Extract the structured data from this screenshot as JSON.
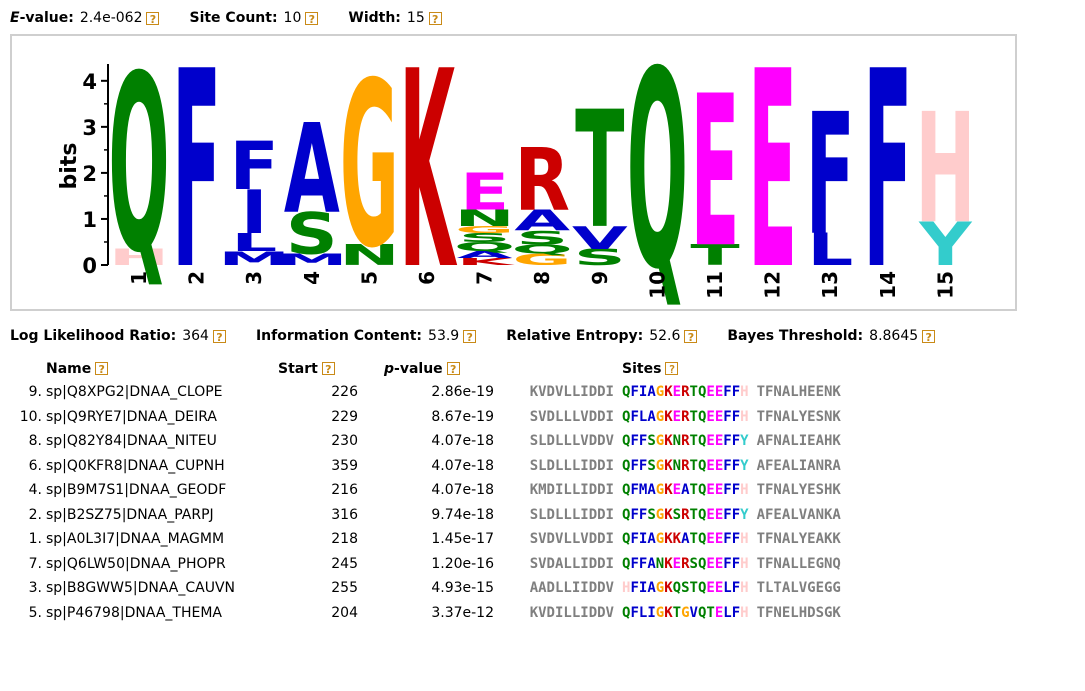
{
  "header": {
    "evalue": {
      "label": "E-value:",
      "value": "2.4e-062"
    },
    "site_count": {
      "label": "Site Count:",
      "value": "10"
    },
    "width": {
      "label": "Width:",
      "value": "15"
    }
  },
  "help_icon": {
    "glyph": "?",
    "color": "#c98a17"
  },
  "logo": {
    "ylabel": "bits",
    "y_ticks": [
      "0",
      "1",
      "2",
      "3",
      "4"
    ],
    "ylim": [
      0,
      4.3
    ],
    "positions": [
      "1",
      "2",
      "3",
      "4",
      "5",
      "6",
      "7",
      "8",
      "9",
      "10",
      "11",
      "12",
      "13",
      "14",
      "15"
    ],
    "columns": [
      [
        {
          "l": "H",
          "b": 0.35
        },
        {
          "l": "Q",
          "b": 3.85
        }
      ],
      [
        {
          "l": "F",
          "b": 4.3
        }
      ],
      [
        {
          "l": "M",
          "b": 0.3
        },
        {
          "l": "L",
          "b": 0.4
        },
        {
          "l": "I",
          "b": 0.95
        },
        {
          "l": "F",
          "b": 1.05
        }
      ],
      [
        {
          "l": "M",
          "b": 0.25
        },
        {
          "l": "S",
          "b": 0.9
        },
        {
          "l": "A",
          "b": 1.95
        }
      ],
      [
        {
          "l": "N",
          "b": 0.45
        },
        {
          "l": "G",
          "b": 3.6
        }
      ],
      [
        {
          "l": "K",
          "b": 4.3
        }
      ],
      [
        {
          "l": "K",
          "b": 0.15
        },
        {
          "l": "A",
          "b": 0.15
        },
        {
          "l": "Q",
          "b": 0.2
        },
        {
          "l": "S",
          "b": 0.2
        },
        {
          "l": "G",
          "b": 0.15
        },
        {
          "l": "N",
          "b": 0.35
        },
        {
          "l": "E",
          "b": 0.8
        }
      ],
      [
        {
          "l": "G",
          "b": 0.25
        },
        {
          "l": "Q",
          "b": 0.2
        },
        {
          "l": "S",
          "b": 0.3
        },
        {
          "l": "A",
          "b": 0.45
        },
        {
          "l": "R",
          "b": 1.35
        }
      ],
      [
        {
          "l": "S",
          "b": 0.35
        },
        {
          "l": "V",
          "b": 0.5
        },
        {
          "l": "T",
          "b": 2.55
        }
      ],
      [
        {
          "l": "Q",
          "b": 4.3
        }
      ],
      [
        {
          "l": "T",
          "b": 0.45
        },
        {
          "l": "E",
          "b": 3.3
        }
      ],
      [
        {
          "l": "E",
          "b": 4.3
        }
      ],
      [
        {
          "l": "L",
          "b": 0.7
        },
        {
          "l": "F",
          "b": 2.65
        }
      ],
      [
        {
          "l": "F",
          "b": 4.3
        }
      ],
      [
        {
          "l": "Y",
          "b": 0.95
        },
        {
          "l": "H",
          "b": 2.4
        }
      ]
    ]
  },
  "stats2": {
    "llr": {
      "label": "Log Likelihood Ratio:",
      "value": "364"
    },
    "ic": {
      "label": "Information Content:",
      "value": "53.9"
    },
    "re": {
      "label": "Relative Entropy:",
      "value": "52.6"
    },
    "bt": {
      "label": "Bayes Threshold:",
      "value": "8.8645"
    }
  },
  "table": {
    "headers": {
      "name": "Name",
      "start": "Start",
      "pvalue_p": "p",
      "pvalue_rest": "-value",
      "sites": "Sites"
    },
    "rows": [
      {
        "idx": "9.",
        "name": "sp|Q8XPG2|DNAA_CLOPE",
        "start": "226",
        "pvalue": "2.86e-19",
        "left": "KVDVLLIDDI",
        "site": "QFIAGKERTQEEFFH",
        "right": "TFNALHEENK"
      },
      {
        "idx": "10.",
        "name": "sp|Q9RYE7|DNAA_DEIRA",
        "start": "229",
        "pvalue": "8.67e-19",
        "left": "SVDLLLVDDI",
        "site": "QFLAGKERTQEEFFH",
        "right": "TFNALYESNK"
      },
      {
        "idx": "8.",
        "name": "sp|Q82Y84|DNAA_NITEU",
        "start": "230",
        "pvalue": "4.07e-18",
        "left": "SLDLLLVDDV",
        "site": "QFFSGKNRTQEEFFY",
        "right": "AFNALIEAHK"
      },
      {
        "idx": "6.",
        "name": "sp|Q0KFR8|DNAA_CUPNH",
        "start": "359",
        "pvalue": "4.07e-18",
        "left": "SLDLLLIDDI",
        "site": "QFFSGKNRTQEEFFY",
        "right": "AFEALIANRA"
      },
      {
        "idx": "4.",
        "name": "sp|B9M7S1|DNAA_GEODF",
        "start": "216",
        "pvalue": "4.07e-18",
        "left": "KMDILLIDDI",
        "site": "QFMAGKEATQEEFFH",
        "right": "TFNALYESHK"
      },
      {
        "idx": "2.",
        "name": "sp|B2SZ75|DNAA_PARPJ",
        "start": "316",
        "pvalue": "9.74e-18",
        "left": "SLDLLLIDDI",
        "site": "QFFSGKSRTQEEFFY",
        "right": "AFEALVANKA"
      },
      {
        "idx": "1.",
        "name": "sp|A0L3I7|DNAA_MAGMM",
        "start": "218",
        "pvalue": "1.45e-17",
        "left": "SVDVLLVDDI",
        "site": "QFIAGKKATQEEFFH",
        "right": "TFNALYEAKK"
      },
      {
        "idx": "7.",
        "name": "sp|Q6LW50|DNAA_PHOPR",
        "start": "245",
        "pvalue": "1.20e-16",
        "left": "SVDALLIDDI",
        "site": "QFFANKERSQEEFFH",
        "right": "TFNALLEGNQ"
      },
      {
        "idx": "3.",
        "name": "sp|B8GWW5|DNAA_CAUVN",
        "start": "255",
        "pvalue": "4.93e-15",
        "left": "AADLLIIDDV",
        "site": "HFIAGKQSTQEELFH",
        "right": "TLTALVGEGG"
      },
      {
        "idx": "5.",
        "name": "sp|P46798|DNAA_THEMA",
        "start": "204",
        "pvalue": "3.37e-12",
        "left": "KVDILLIDDV",
        "site": "QFLIGKTGVQTELFH",
        "right": "TFNELHDSGK"
      }
    ]
  },
  "colors": {
    "A": "#0000cc",
    "C": "#0000cc",
    "F": "#0000cc",
    "I": "#0000cc",
    "L": "#0000cc",
    "M": "#0000cc",
    "V": "#0000cc",
    "W": "#0000cc",
    "N": "#008000",
    "Q": "#008000",
    "S": "#008000",
    "T": "#008000",
    "D": "#ff00ff",
    "E": "#ff00ff",
    "K": "#cc0000",
    "R": "#cc0000",
    "G": "#ffa500",
    "H": "#ffcccc",
    "Y": "#33cccc",
    "P": "#ffff00",
    "flank": "#7f7f7f"
  }
}
